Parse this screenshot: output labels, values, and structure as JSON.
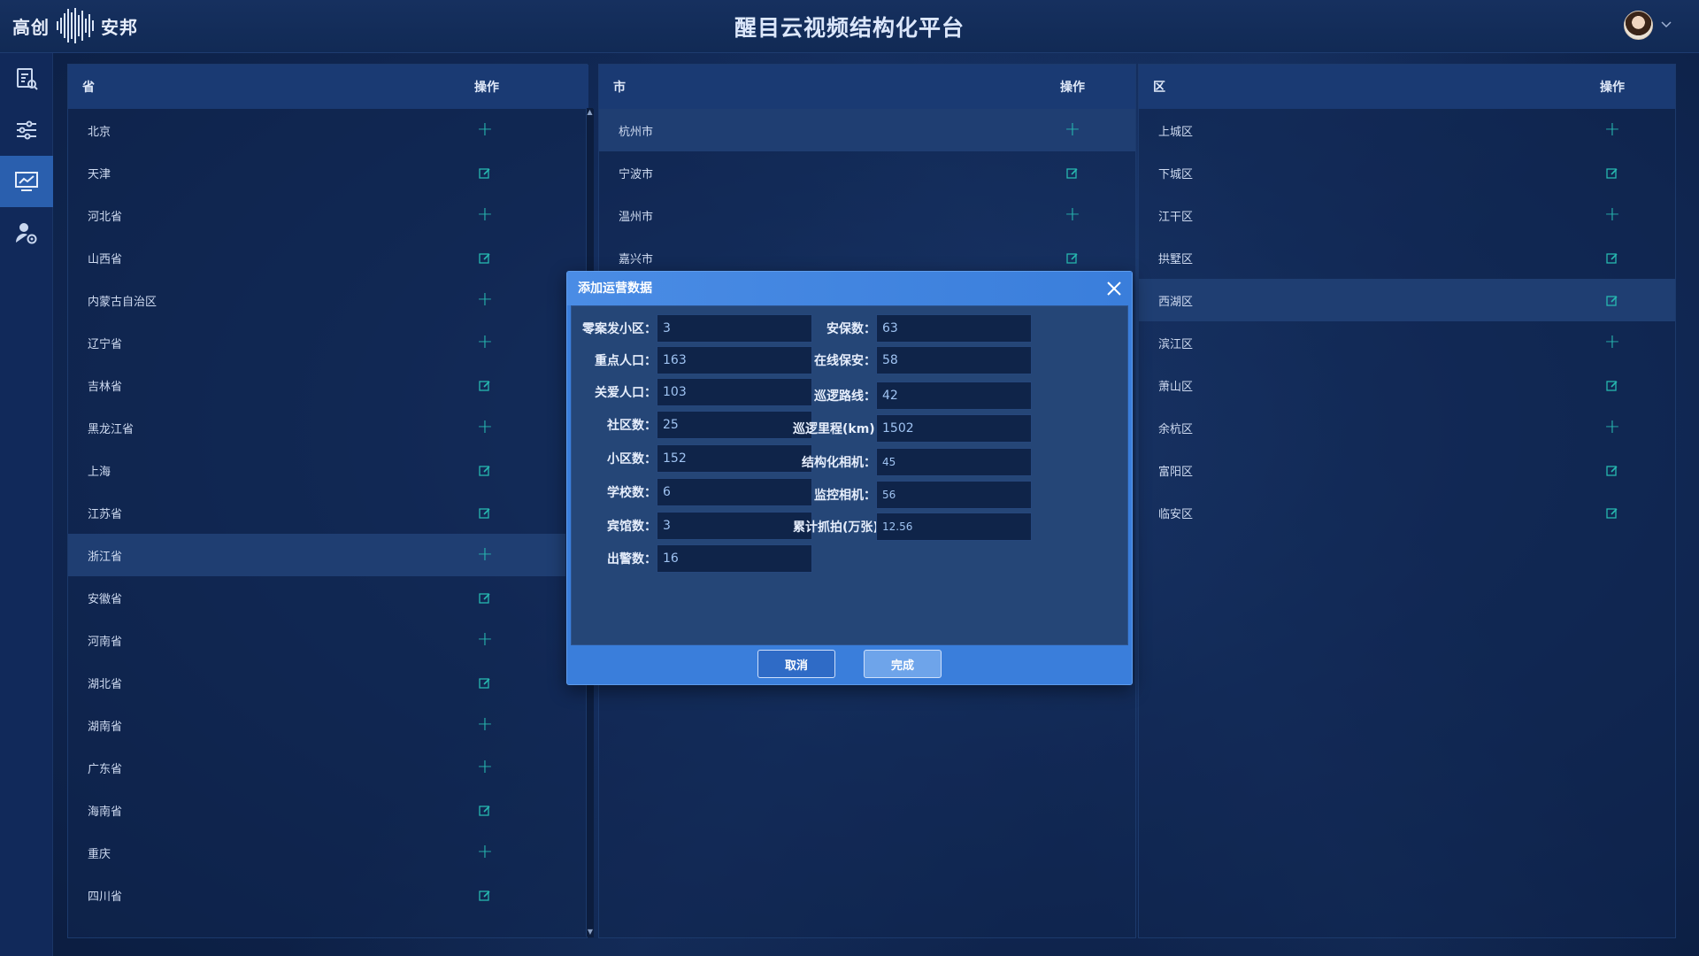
{
  "app": {
    "title": "醒目云视频结构化平台",
    "logo_left": "高创",
    "logo_right": "安邦"
  },
  "sidebar": {
    "items": [
      {
        "icon": "report-icon"
      },
      {
        "icon": "sliders-icon"
      },
      {
        "icon": "monitor-chart-icon",
        "active": true
      },
      {
        "icon": "user-settings-icon"
      }
    ]
  },
  "panels": {
    "province": {
      "header": "省",
      "op_header": "操作",
      "rows": [
        {
          "name": "北京",
          "action": "add"
        },
        {
          "name": "天津",
          "action": "edit"
        },
        {
          "name": "河北省",
          "action": "add"
        },
        {
          "name": "山西省",
          "action": "edit"
        },
        {
          "name": "内蒙古自治区",
          "action": "add"
        },
        {
          "name": "辽宁省",
          "action": "add"
        },
        {
          "name": "吉林省",
          "action": "edit"
        },
        {
          "name": "黑龙江省",
          "action": "add"
        },
        {
          "name": "上海",
          "action": "edit"
        },
        {
          "name": "江苏省",
          "action": "edit"
        },
        {
          "name": "浙江省",
          "action": "add",
          "selected": true
        },
        {
          "name": "安徽省",
          "action": "edit"
        },
        {
          "name": "河南省",
          "action": "add"
        },
        {
          "name": "湖北省",
          "action": "edit"
        },
        {
          "name": "湖南省",
          "action": "add"
        },
        {
          "name": "广东省",
          "action": "add"
        },
        {
          "name": "海南省",
          "action": "edit"
        },
        {
          "name": "重庆",
          "action": "add"
        },
        {
          "name": "四川省",
          "action": "edit"
        }
      ]
    },
    "city": {
      "header": "市",
      "op_header": "操作",
      "rows": [
        {
          "name": "杭州市",
          "action": "add",
          "selected": true
        },
        {
          "name": "宁波市",
          "action": "edit"
        },
        {
          "name": "温州市",
          "action": "add"
        },
        {
          "name": "嘉兴市",
          "action": "edit"
        }
      ]
    },
    "district": {
      "header": "区",
      "op_header": "操作",
      "rows": [
        {
          "name": "上城区",
          "action": "add"
        },
        {
          "name": "下城区",
          "action": "edit"
        },
        {
          "name": "江干区",
          "action": "add"
        },
        {
          "name": "拱墅区",
          "action": "edit"
        },
        {
          "name": "西湖区",
          "action": "edit",
          "selected": true
        },
        {
          "name": "滨江区",
          "action": "add"
        },
        {
          "name": "萧山区",
          "action": "edit"
        },
        {
          "name": "余杭区",
          "action": "add"
        },
        {
          "name": "富阳区",
          "action": "edit"
        },
        {
          "name": "临安区",
          "action": "edit"
        }
      ]
    }
  },
  "modal": {
    "title": "添加运营数据",
    "left_fields": [
      {
        "label": "零案发小区：",
        "value": "3"
      },
      {
        "label": "重点人口：",
        "value": "163"
      },
      {
        "label": "关爱人口：",
        "value": "103"
      },
      {
        "label": "社区数：",
        "value": "25"
      },
      {
        "label": "小区数：",
        "value": "152"
      },
      {
        "label": "学校数：",
        "value": "6"
      },
      {
        "label": "宾馆数：",
        "value": "3"
      },
      {
        "label": "出警数：",
        "value": "16"
      }
    ],
    "right_fields": [
      {
        "label": "安保数：",
        "value": "63"
      },
      {
        "label": "在线保安：",
        "value": "58"
      },
      {
        "label": "巡逻路线：",
        "value": "42"
      },
      {
        "label": "巡逻里程(km)：",
        "value": "1502"
      },
      {
        "label": "结构化相机：",
        "value": "45"
      },
      {
        "label": "监控相机：",
        "value": "56"
      },
      {
        "label": "累计抓拍(万张)：",
        "value": "12.56"
      }
    ],
    "cancel_label": "取消",
    "ok_label": "完成"
  }
}
